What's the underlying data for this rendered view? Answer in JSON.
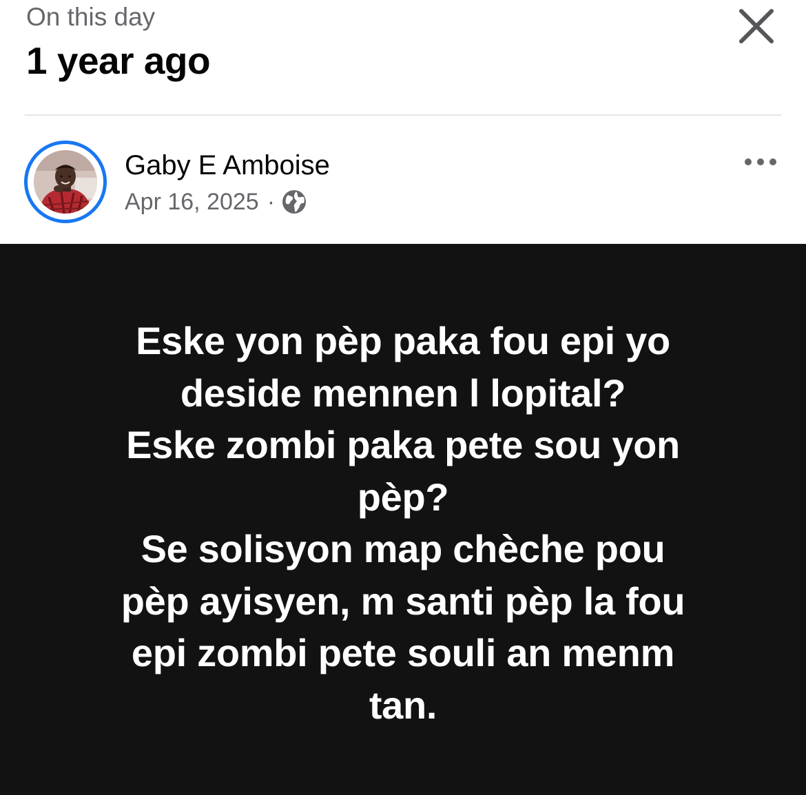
{
  "header": {
    "subtitle": "On this day",
    "title": "1 year ago",
    "close_icon": "close-icon"
  },
  "post": {
    "author": {
      "name": "Gaby E Amboise",
      "avatar_icon": "profile-photo"
    },
    "date": "Apr 16, 2025",
    "separator": "·",
    "audience_icon": "globe-icon",
    "more_icon": "more-options-icon",
    "text": "Eske yon pèp paka fou epi yo\ndeside mennen l lopital?\nEske zombi paka pete sou yon\npèp?\nSe solisyon map chèche pou\npèp ayisyen, m santi pèp la fou\nepi zombi pete souli an menm\ntan.",
    "background_color": "#121212",
    "text_color": "#ffffff"
  },
  "colors": {
    "accent": "#1877f2",
    "secondary_text": "#65676b",
    "primary_text": "#050505",
    "divider": "#e4e6eb"
  }
}
